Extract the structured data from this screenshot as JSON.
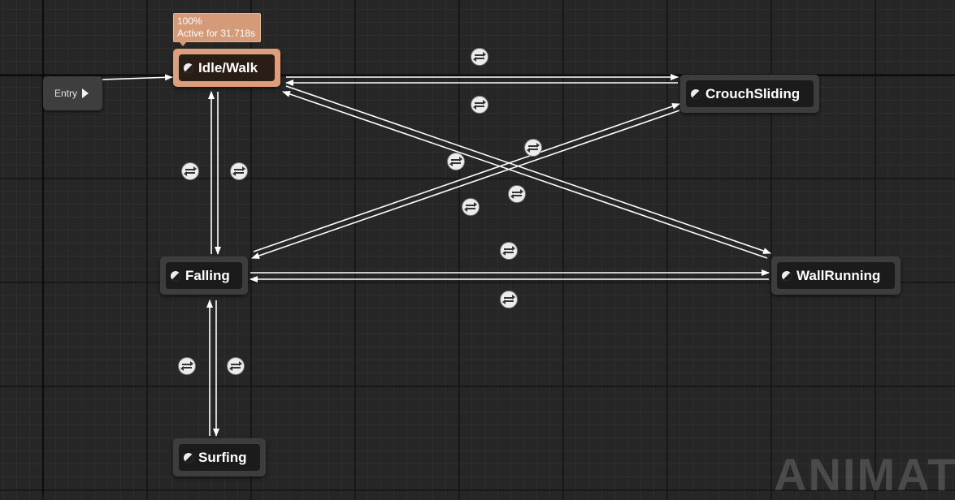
{
  "graph": {
    "entry": {
      "label": "Entry"
    },
    "active_tooltip": {
      "weight": "100%",
      "status": "Active for 31.718s"
    },
    "states": {
      "idle_walk": "Idle/Walk",
      "crouch_sliding": "CrouchSliding",
      "falling": "Falling",
      "wall_running": "WallRunning",
      "surfing": "Surfing"
    },
    "transitions": [
      {
        "from": "Entry",
        "to": "Idle/Walk"
      },
      {
        "from": "Idle/Walk",
        "to": "CrouchSliding"
      },
      {
        "from": "CrouchSliding",
        "to": "Idle/Walk"
      },
      {
        "from": "Idle/Walk",
        "to": "Falling"
      },
      {
        "from": "Falling",
        "to": "Idle/Walk"
      },
      {
        "from": "Idle/Walk",
        "to": "WallRunning"
      },
      {
        "from": "WallRunning",
        "to": "Idle/Walk"
      },
      {
        "from": "Falling",
        "to": "CrouchSliding"
      },
      {
        "from": "CrouchSliding",
        "to": "Falling"
      },
      {
        "from": "Falling",
        "to": "WallRunning"
      },
      {
        "from": "WallRunning",
        "to": "Falling"
      },
      {
        "from": "Falling",
        "to": "Surfing"
      },
      {
        "from": "Surfing",
        "to": "Falling"
      }
    ],
    "watermark": "ANIMATI"
  },
  "colors": {
    "active_state": "#dc9e7c",
    "state_body": "#3d3d3d",
    "grid_background": "#262626"
  },
  "icons": {
    "state": "state-half-circle-icon",
    "entry": "entry-arrow-icon",
    "transition": "transition-rule-icon"
  }
}
